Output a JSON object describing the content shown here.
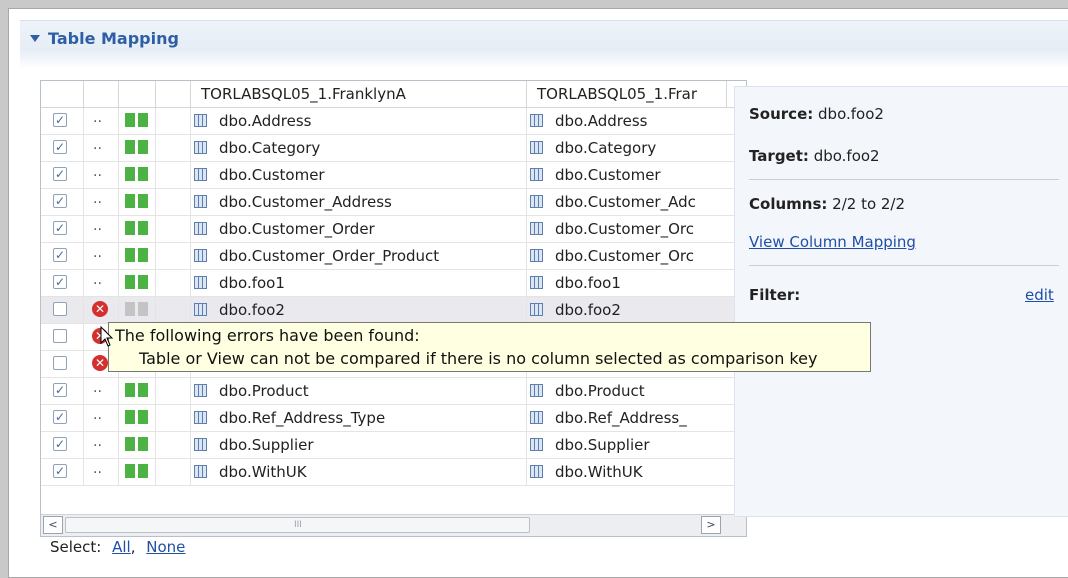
{
  "section": {
    "title": "Table Mapping"
  },
  "table": {
    "columns": [
      "",
      "",
      "",
      "",
      "TORLABSQL05_1.FranklynA",
      "TORLABSQL05_1.Frar"
    ],
    "rows": [
      {
        "checked": true,
        "status": "ok",
        "source": "dbo.Address",
        "target": "dbo.Address"
      },
      {
        "checked": true,
        "status": "ok",
        "source": "dbo.Category",
        "target": "dbo.Category"
      },
      {
        "checked": true,
        "status": "ok",
        "source": "dbo.Customer",
        "target": "dbo.Customer"
      },
      {
        "checked": true,
        "status": "ok",
        "source": "dbo.Customer_Address",
        "target": "dbo.Customer_Adc"
      },
      {
        "checked": true,
        "status": "ok",
        "source": "dbo.Customer_Order",
        "target": "dbo.Customer_Orc"
      },
      {
        "checked": true,
        "status": "ok",
        "source": "dbo.Customer_Order_Product",
        "target": "dbo.Customer_Orc"
      },
      {
        "checked": true,
        "status": "ok",
        "source": "dbo.foo1",
        "target": "dbo.foo1"
      },
      {
        "checked": false,
        "status": "error",
        "source": "dbo.foo2",
        "target": "dbo.foo2"
      },
      {
        "checked": false,
        "status": "error",
        "source": "",
        "target": ""
      },
      {
        "checked": false,
        "status": "error",
        "source": "",
        "target": ""
      },
      {
        "checked": true,
        "status": "ok",
        "source": "dbo.Product",
        "target": "dbo.Product"
      },
      {
        "checked": true,
        "status": "ok",
        "source": "dbo.Ref_Address_Type",
        "target": "dbo.Ref_Address_"
      },
      {
        "checked": true,
        "status": "ok",
        "source": "dbo.Supplier",
        "target": "dbo.Supplier"
      },
      {
        "checked": true,
        "status": "ok",
        "source": "dbo.WithUK",
        "target": "dbo.WithUK"
      }
    ],
    "scroll_left": "<",
    "scroll_right": ">",
    "scroll_grip": "III"
  },
  "details": {
    "source_label": "Source:",
    "source_value": "dbo.foo2",
    "target_label": "Target:",
    "target_value": "dbo.foo2",
    "columns_label": "Columns:",
    "columns_value": "2/2 to 2/2",
    "view_mapping": "View Column Mapping",
    "filter_label": "Filter:",
    "filter_edit": "edit"
  },
  "tooltip": {
    "line1": "The following errors have been found:",
    "line2": "Table or View can not be compared if there is no column selected as comparison key"
  },
  "select": {
    "label": "Select:",
    "all": "All",
    "separator": ",",
    "none": "None"
  },
  "colors": {
    "accent": "#2e5fa5",
    "ok": "#4bb243",
    "error": "#d43030",
    "link": "#1f4fa8",
    "tooltip_bg": "#ffffe1"
  },
  "icons": {
    "ok_status": "green-bars-icon",
    "error_status": "error-x-icon",
    "table": "table-icon",
    "expand": "triangle-down-icon"
  }
}
